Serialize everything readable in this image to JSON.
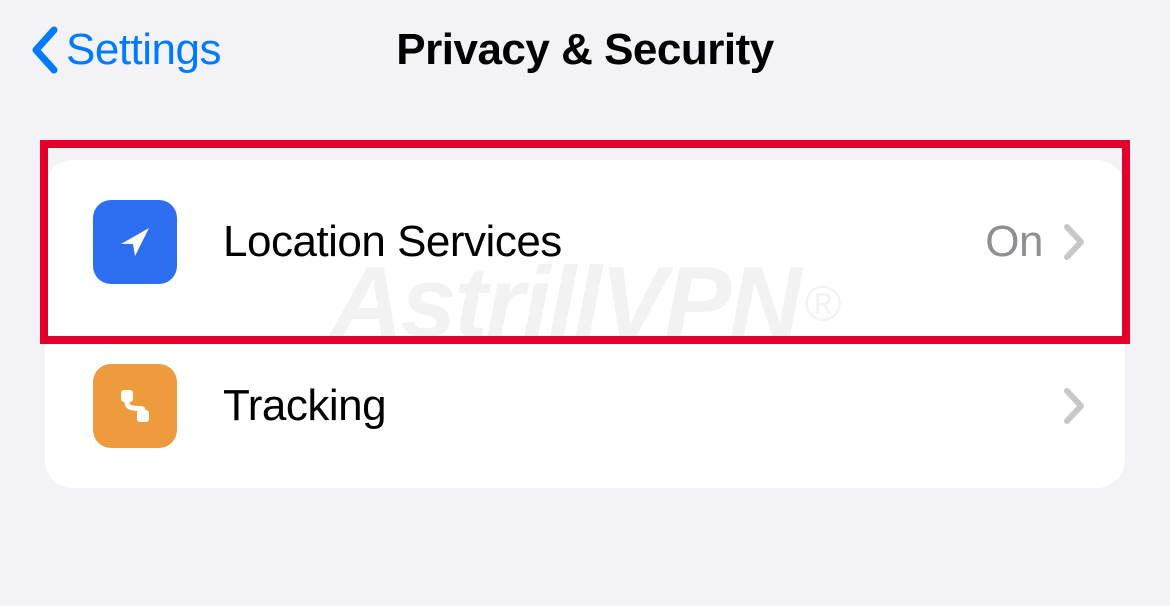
{
  "header": {
    "back_label": "Settings",
    "title": "Privacy & Security"
  },
  "items": [
    {
      "label": "Location Services",
      "value": "On"
    },
    {
      "label": "Tracking",
      "value": ""
    }
  ],
  "watermark": "AstrillVPN"
}
